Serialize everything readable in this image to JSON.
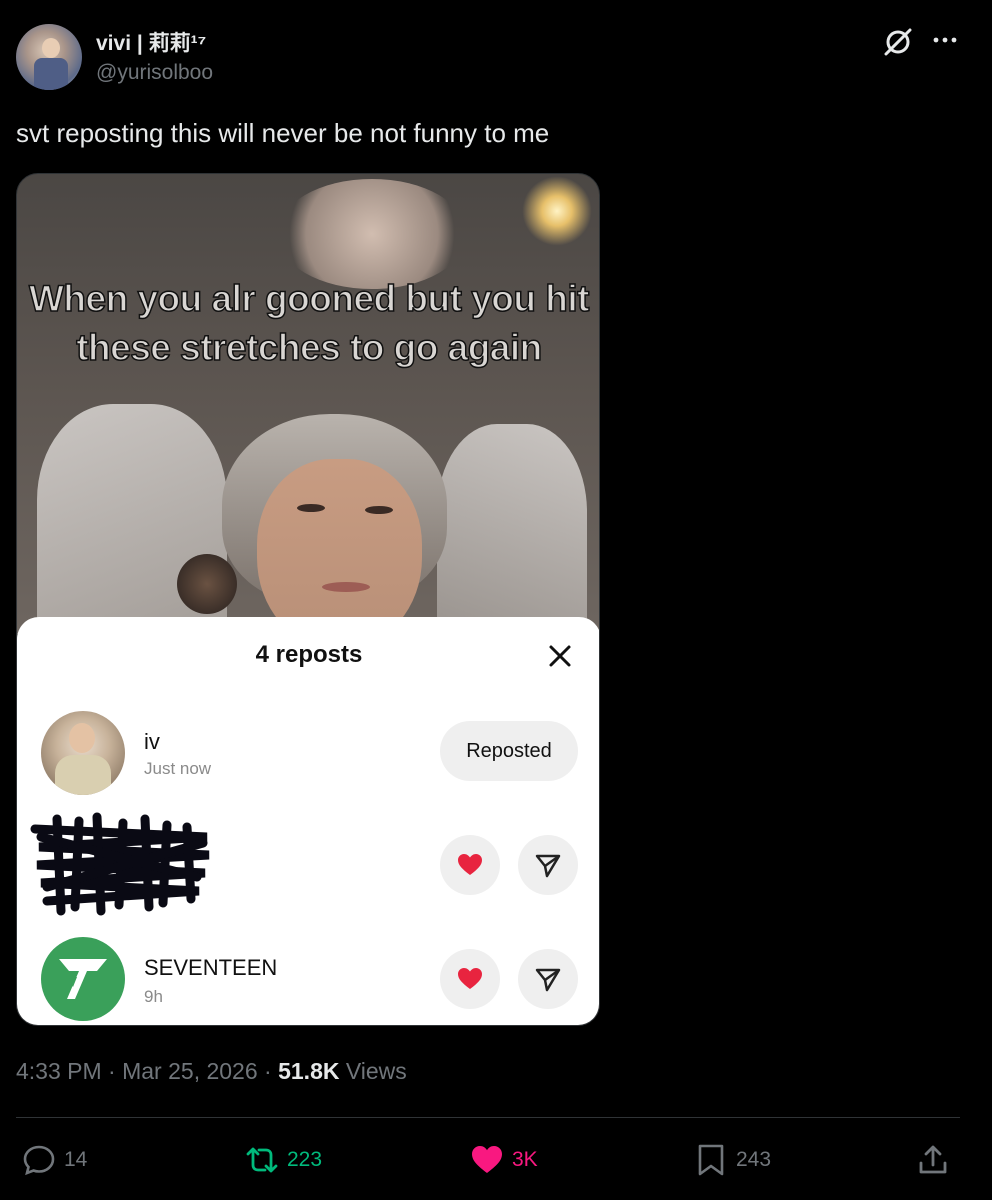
{
  "tweet": {
    "author": {
      "display_name": "vivi | 莉莉¹⁷",
      "handle": "@yurisolboo"
    },
    "text": "svt reposting this will never be not funny to me",
    "media": {
      "meme_text": "When you alr gooned but you hit these stretches to go again",
      "sheet": {
        "title": "4 reposts",
        "rows": [
          {
            "name": "iv",
            "time": "Just now",
            "action_label": "Reposted"
          },
          {
            "name": "",
            "time": ""
          },
          {
            "name": "SEVENTEEN",
            "time": "9h"
          }
        ]
      }
    },
    "timestamp": {
      "time": "4:33 PM",
      "separator": " · ",
      "date": "Mar 25, 2026",
      "views_count": "51.8K",
      "views_label": "Views"
    },
    "actions": {
      "replies": "14",
      "reposts": "223",
      "likes": "3K",
      "bookmarks": "243"
    }
  },
  "colors": {
    "background": "#000000",
    "text_primary": "#e7e9ea",
    "text_secondary": "#71767b",
    "repost_green": "#00ba7c",
    "like_pink": "#f91880",
    "seventeen_green": "#3aa05a"
  },
  "icons": [
    "grok-icon",
    "more-icon",
    "close-icon",
    "heart-icon",
    "send-icon",
    "reply-icon",
    "repost-icon",
    "like-icon",
    "bookmark-icon",
    "share-icon"
  ]
}
